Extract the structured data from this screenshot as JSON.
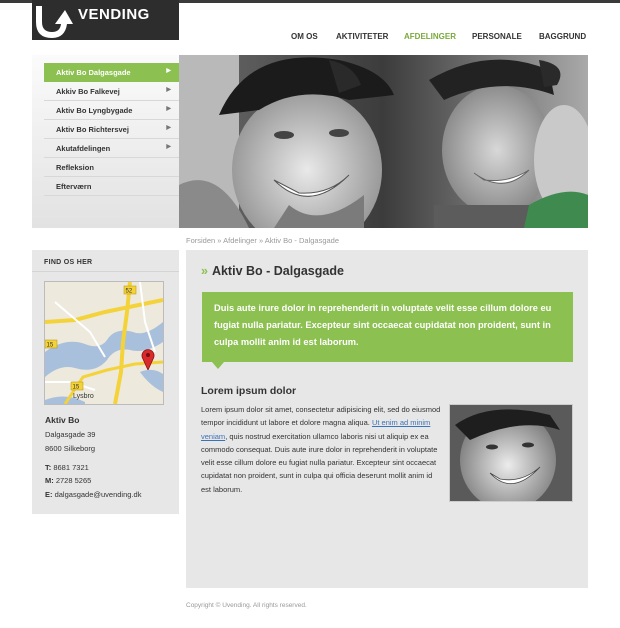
{
  "brand": {
    "name": "VENDING"
  },
  "nav": {
    "items": [
      {
        "label": "OM OS",
        "active": false
      },
      {
        "label": "AKTIVITETER",
        "active": false
      },
      {
        "label": "AFDELINGER",
        "active": true
      },
      {
        "label": "PERSONALE",
        "active": false
      },
      {
        "label": "BAGGRUND",
        "active": false
      }
    ]
  },
  "submenu": {
    "items": [
      {
        "label": "Aktiv Bo Dalgasgade",
        "has_arrow": true,
        "active": true
      },
      {
        "label": "Akkiv Bo Falkevej",
        "has_arrow": true,
        "active": false
      },
      {
        "label": "Aktiv Bo Lyngbygade",
        "has_arrow": true,
        "active": false
      },
      {
        "label": "Aktiv Bo Richtersvej",
        "has_arrow": true,
        "active": false
      },
      {
        "label": "Akutafdelingen",
        "has_arrow": true,
        "active": false
      },
      {
        "label": "Refleksion",
        "has_arrow": false,
        "active": false
      },
      {
        "label": "Efterværn",
        "has_arrow": false,
        "active": false
      }
    ]
  },
  "breadcrumb": {
    "text": "Forsiden » Afdelinger » Aktiv Bo - Dalgasgade"
  },
  "sidebar": {
    "heading": "FIND OS HER",
    "map": {
      "labels": [
        "15",
        "52",
        "15",
        "Lysbro"
      ]
    },
    "address": {
      "name": "Aktiv Bo",
      "street": "Dalgasgade 39",
      "city": "8600 Silkeborg",
      "phone_label": "T:",
      "phone": "8681 7321",
      "mobile_label": "M:",
      "mobile": "2728 5265",
      "email_label": "E:",
      "email": "dalgasgade@uvending.dk"
    }
  },
  "main": {
    "title": "Aktiv Bo - Dalgasgade",
    "title_chevron": "»",
    "callout": "Duis aute irure dolor in reprehenderit in voluptate velit esse cillum dolore eu fugiat nulla pariatur.  Excepteur sint occaecat  cupidatat non proident, sunt in culpa mollit anim id est laborum.",
    "subtitle": "Lorem ipsum dolor",
    "body_before_link": "Lorem ipsum dolor sit amet, consectetur adipisicing elit, sed do eiusmod tempor incididunt ut labore et dolore magna aliqua. ",
    "body_link": "Ut enim ad minim veniam",
    "body_after_link": ", quis nostrud exercitation ullamco laboris nisi ut aliquip ex ea commodo consequat. Duis aute irure dolor in reprehenderit in voluptate velit esse cillum dolore eu fugiat nulla pariatur. Excepteur sint occaecat cupidatat non proident, sunt in culpa qui officia deserunt mollit anim id est laborum."
  },
  "footer": {
    "text": "Copyright © Uvending. All rights reserved."
  },
  "colors": {
    "accent": "#8cc051",
    "nav_active": "#7aa93c",
    "logo_bg": "#2d2d2d",
    "panel": "#e7e7e7",
    "link": "#3b73b9"
  }
}
